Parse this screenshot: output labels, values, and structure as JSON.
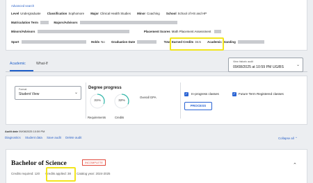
{
  "student": {
    "advanced_search": "Advanced search",
    "level_label": "Level",
    "level_value": "Undergraduate",
    "classification_label": "Classification",
    "classification_value": "Sophomore",
    "major_label": "Major",
    "major_value": "Clinical Health Studies",
    "minor_label": "Minor",
    "minor_value": "Coaching",
    "school_label": "School",
    "school_value": "School of HS and HP",
    "matriculation_label": "Matriculation Term",
    "majors_advisors_label": "Majors/Advisors",
    "minors_advisors_label": "Minors/Advisors",
    "placement_label": "Placement Scores",
    "placement_value": "Math Placement Assessment",
    "sport_label": "Sport",
    "holds_label": "Holds",
    "holds_value": "No",
    "graduation_date_label": "Graduation Date",
    "total_earned_credits_label": "Total Earned Credits",
    "total_earned_credits_value": "34.5",
    "academic_standing_label": "Academic Standing"
  },
  "tabs": {
    "academic": "Academic",
    "what_if": "What-If"
  },
  "audit_select": {
    "label": "View historic audit",
    "value": "09/08/2025 at 10:59 PM UG/BS"
  },
  "format": {
    "label": "Format",
    "value": "Student View"
  },
  "degree_progress": {
    "title": "Degree progress",
    "requirements_percent": "31%",
    "credits_percent": "32%",
    "requirements_label": "Requirements",
    "credits_label": "Credits",
    "overall_gpa_label": "Overall GPA"
  },
  "options": {
    "in_progress_label": "In-progress classes",
    "future_term_label": "Future Term Registered classes",
    "process_label": "PROCESS"
  },
  "audit_date": {
    "label": "Audit date",
    "value": "09/08/2025 10:59 PM"
  },
  "actions": [
    "Diagnostics",
    "Student data",
    "Save audit",
    "Delete audit"
  ],
  "collapse_all": "Collapse all",
  "degree": {
    "title": "Bachelor of Science",
    "status": "INCOMPLETE",
    "credits_required_label": "Credits required:",
    "credits_required_value": "120",
    "credits_applied_label": "Credits applied:",
    "credits_applied_value": "38",
    "catalog_year_label": "Catalog year:",
    "catalog_year_value": "2024-2025"
  },
  "colors": {
    "accent": "#1f5fc9",
    "highlight": "#f2e51c",
    "incomplete": "#e1473a",
    "ring": "#2bb5a7"
  }
}
